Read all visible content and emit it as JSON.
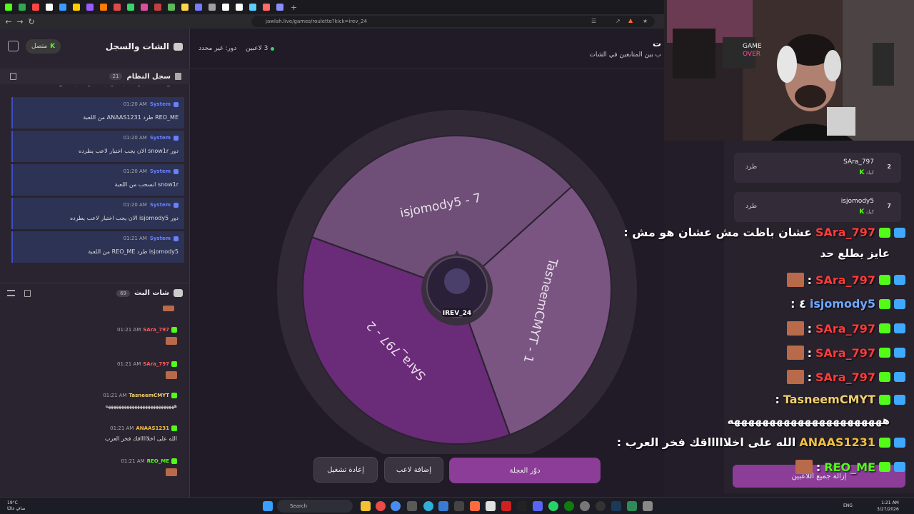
{
  "browser": {
    "url": "jawlah.live/games/roulette?kick=irev_24",
    "tab_colors": [
      "#53fc18",
      "#2fa84f",
      "#ff4444",
      "#ffffff",
      "#3a9bff",
      "#ffcc00",
      "#9b59ff",
      "#ff7a00",
      "#e04a4a",
      "#3ad36b",
      "#d94f9e",
      "#c04040",
      "#5cb85c",
      "#ffd54a",
      "#7a7aff",
      "#a0a0a0",
      "#ffffff",
      "#ffffff",
      "#5ad0ff",
      "#ff6a6a",
      "#8c8cff"
    ]
  },
  "left_panel": {
    "title": "الشات والسجل",
    "status": "متصل",
    "system_log": {
      "title": "سجل النظام",
      "count": "21",
      "partial_text": "REO_ME: اختيار خاطئ - يرجى اختيار لاعب صحيح",
      "messages": [
        {
          "name": "System",
          "time": "01:20 AM",
          "text": "REO_ME طرد ANAAS1231 من اللعبة"
        },
        {
          "name": "System",
          "time": "01:20 AM",
          "text": "دور snow1r الان يجب اختيار لاعب يطرده"
        },
        {
          "name": "System",
          "time": "01:20 AM",
          "text": "snow1r انسحب من اللعبة"
        },
        {
          "name": "System",
          "time": "01:20 AM",
          "text": "دور isjomody5 الان يجب اختيار لاعب يطرده"
        },
        {
          "name": "System",
          "time": "01:21 AM",
          "text": "isjomody5 طرد REO_ME من اللعبة"
        }
      ]
    },
    "stream_chat": {
      "title": "شات البث",
      "count": "69",
      "messages": [
        {
          "user": "SAra_797",
          "color": "#ff5c5c",
          "time": "01:21 AM",
          "text": "",
          "emote": true
        },
        {
          "user": "SAra_797",
          "color": "#ff5c5c",
          "time": "01:21 AM",
          "text": "",
          "emote": true
        },
        {
          "user": "TasneemCMYT",
          "color": "#f0d070",
          "time": "01:21 AM",
          "text": "ههههههههههههههههههههههههههه",
          "emote": false
        },
        {
          "user": "ANAAS1231",
          "color": "#f0c040",
          "time": "01:21 AM",
          "text": "الله على اخلاااااقك فخر العرب",
          "emote": false
        },
        {
          "user": "REO_ME",
          "color": "#53fc18",
          "time": "01:21 AM",
          "text": "",
          "emote": true
        }
      ]
    }
  },
  "main": {
    "title_partial": "ت",
    "subtitle_partial": "ب بين المتابعين في الشات",
    "players_count": "3 لاعبين",
    "turn": "دور: غير محدد",
    "wheel": {
      "center_label": "IREV_24",
      "segments": [
        {
          "label": "TasneemCMYT - 1",
          "color": "#7a5582"
        },
        {
          "label": "SAra_797 - 2",
          "color": "#6a2b78"
        },
        {
          "label": "isjomody5 - 7",
          "color": "#6f4f78"
        }
      ]
    },
    "buttons": {
      "spin": "دوّر العجلة",
      "add_player": "إضافة لاعب",
      "restart": "إعادة تشغيل"
    }
  },
  "players_panel": {
    "rows": [
      {
        "rank": "2",
        "name": "SAra_797",
        "platform": "كيك",
        "kick_label": "طرد"
      },
      {
        "rank": "7",
        "name": "isjomody5",
        "platform": "كيك",
        "kick_label": "طرد"
      }
    ],
    "clear_button": "إزالة جميع اللاعبين"
  },
  "overlay_chat": [
    {
      "user": "SAra_797",
      "color": "#ff3b3b",
      "text": ": عشان باظت مش عشان هو مش",
      "cont": "عايز يطلع حد"
    },
    {
      "user": "SAra_797",
      "color": "#ff3b3b",
      "text": ":",
      "emote": true
    },
    {
      "user": "isjomody5",
      "color": "#6fa8ff",
      "text": ": ٤"
    },
    {
      "user": "SAra_797",
      "color": "#ff3b3b",
      "text": ":",
      "emote": true
    },
    {
      "user": "SAra_797",
      "color": "#ff3b3b",
      "text": ":",
      "emote": true
    },
    {
      "user": "SAra_797",
      "color": "#ff3b3b",
      "text": ":",
      "emote": true
    },
    {
      "user": "TasneemCMYT",
      "color": "#f0d070",
      "text": ":",
      "cont": "ههههههههههههههههههههههه"
    },
    {
      "user": "ANAAS1231",
      "color": "#f0c040",
      "text": ": الله على اخلاااااقك فخر العرب"
    },
    {
      "user": "REO_ME",
      "color": "#53fc18",
      "text": ":",
      "emote": true
    }
  ],
  "taskbar": {
    "weather_temp": "19°C",
    "weather_desc": "صافٍ غالبًا",
    "search_placeholder": "Search",
    "lang": "ENG",
    "time": "1:21 AM",
    "date": "3/27/2026"
  }
}
